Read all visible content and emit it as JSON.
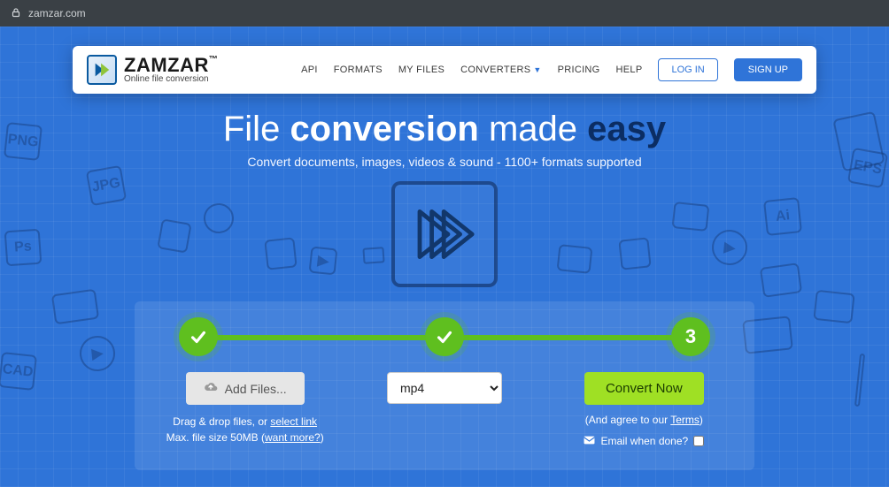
{
  "browser": {
    "url": "zamzar.com"
  },
  "brand": {
    "name": "ZAMZAR",
    "tagline": "Online file conversion",
    "tm": "™"
  },
  "nav": {
    "api": "API",
    "formats": "FORMATS",
    "myfiles": "MY FILES",
    "converters": "CONVERTERS",
    "pricing": "PRICING",
    "help": "HELP",
    "login": "LOG IN",
    "signup": "SIGN UP"
  },
  "hero": {
    "w1": "File ",
    "w2": "conversion",
    "w3": " made ",
    "w4": "easy",
    "subtitle": "Convert documents, images, videos & sound - 1100+ formats supported"
  },
  "steps": {
    "s3_label": "3"
  },
  "converter": {
    "add_files": "Add Files...",
    "drag_prefix": "Drag & drop files, or ",
    "drag_link": "select link",
    "max_prefix": "Max. file size 50MB (",
    "max_link": "want more?",
    "max_suffix": ")",
    "format_selected": "mp4",
    "convert": "Convert Now",
    "agree_prefix": "(And agree to our ",
    "agree_link": "Terms",
    "agree_suffix": ")",
    "email_label": "Email when done?"
  }
}
